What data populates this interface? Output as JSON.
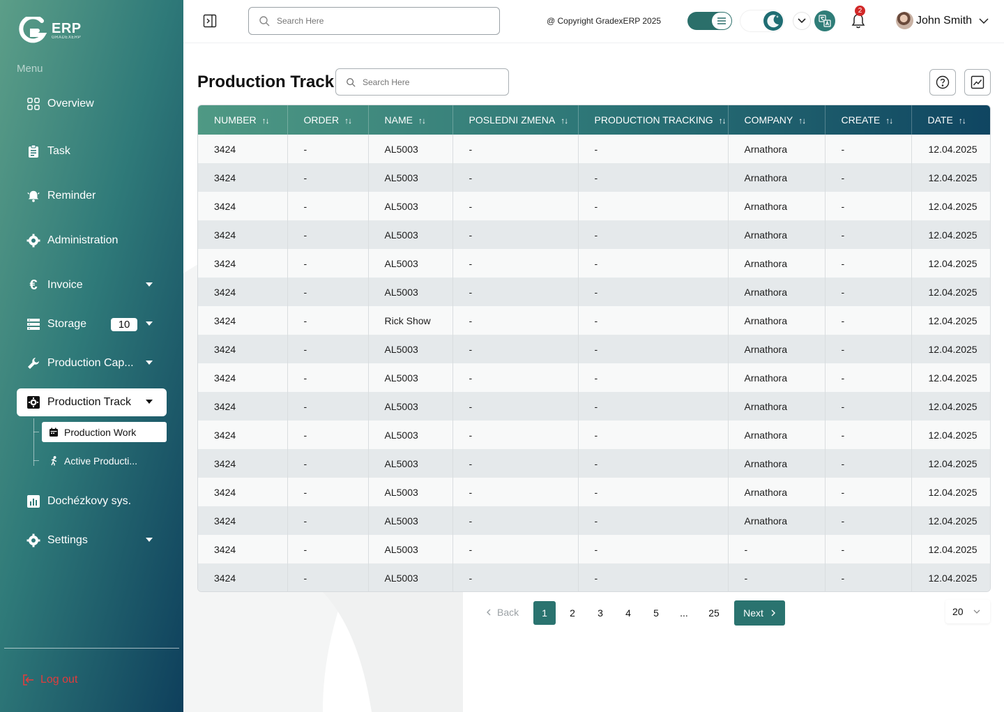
{
  "sidebar": {
    "logo": {
      "title": "ERP",
      "subtitle": "GRADEXERP"
    },
    "menu_label": "Menu",
    "items": [
      {
        "label": "Overview",
        "icon": "grid-icon"
      },
      {
        "label": "Task",
        "icon": "clipboard-icon"
      },
      {
        "label": "Reminder",
        "icon": "bell-ring-icon"
      },
      {
        "label": "Administration",
        "icon": "gear-icon"
      },
      {
        "label": "Invoice",
        "icon": "euro-icon"
      },
      {
        "label": "Storage",
        "icon": "storage-icon",
        "badge": "10"
      },
      {
        "label": "Production Cap...",
        "icon": "wrench-icon"
      },
      {
        "label": "Production Track",
        "icon": "camera-gear-icon"
      },
      {
        "label": "Dochézkovy sys.",
        "icon": "bar-chart-icon"
      },
      {
        "label": "Settings",
        "icon": "gear-icon"
      }
    ],
    "subitems": [
      {
        "label": "Production Work",
        "icon": "calendar-icon"
      },
      {
        "label": "Active Producti...",
        "icon": "running-icon"
      }
    ],
    "logout_label": "Log out"
  },
  "topbar": {
    "search_placeholder": "Search Here",
    "copyright": "@ Copyright GradexERP 2025",
    "notification_count": "2",
    "user_name": "John Smith"
  },
  "page": {
    "title": "Production Track",
    "search_placeholder": "Search Here"
  },
  "table": {
    "columns": [
      "NUMBER",
      "ORDER",
      "NAME",
      "POSLEDNI ZMENA",
      "PRODUCTION TRACKING",
      "COMPANY",
      "CREATE",
      "DATE"
    ],
    "rows": [
      [
        "3424",
        "-",
        "AL5003",
        "-",
        "-",
        "Arnathora",
        "-",
        "12.04.2025"
      ],
      [
        "3424",
        "-",
        "AL5003",
        "-",
        "-",
        "Arnathora",
        "-",
        "12.04.2025"
      ],
      [
        "3424",
        "-",
        "AL5003",
        "-",
        "-",
        "Arnathora",
        "-",
        "12.04.2025"
      ],
      [
        "3424",
        "-",
        "AL5003",
        "-",
        "-",
        "Arnathora",
        "-",
        "12.04.2025"
      ],
      [
        "3424",
        "-",
        "AL5003",
        "-",
        "-",
        "Arnathora",
        "-",
        "12.04.2025"
      ],
      [
        "3424",
        "-",
        "AL5003",
        "-",
        "-",
        "Arnathora",
        "-",
        "12.04.2025"
      ],
      [
        "3424",
        "-",
        "Rick Show",
        "-",
        "-",
        "Arnathora",
        "-",
        "12.04.2025"
      ],
      [
        "3424",
        "-",
        "AL5003",
        "-",
        "-",
        "Arnathora",
        "-",
        "12.04.2025"
      ],
      [
        "3424",
        "-",
        "AL5003",
        "-",
        "-",
        "Arnathora",
        "-",
        "12.04.2025"
      ],
      [
        "3424",
        "-",
        "AL5003",
        "-",
        "-",
        "Arnathora",
        "-",
        "12.04.2025"
      ],
      [
        "3424",
        "-",
        "AL5003",
        "-",
        "-",
        "Arnathora",
        "-",
        "12.04.2025"
      ],
      [
        "3424",
        "-",
        "AL5003",
        "-",
        "-",
        "Arnathora",
        "-",
        "12.04.2025"
      ],
      [
        "3424",
        "-",
        "AL5003",
        "-",
        "-",
        "Arnathora",
        "-",
        "12.04.2025"
      ],
      [
        "3424",
        "-",
        "AL5003",
        "-",
        "-",
        "Arnathora",
        "-",
        "12.04.2025"
      ],
      [
        "3424",
        "-",
        "AL5003",
        "-",
        "-",
        "-",
        "-",
        "12.04.2025"
      ],
      [
        "3424",
        "-",
        "AL5003",
        "-",
        "-",
        "-",
        "-",
        "12.04.2025"
      ]
    ]
  },
  "pagination": {
    "back_label": "Back",
    "pages": [
      "1",
      "2",
      "3",
      "4",
      "5",
      "...",
      "25"
    ],
    "current": "1",
    "next_label": "Next",
    "per_page": "20"
  },
  "colors": {
    "accent": "#2a736f",
    "sidebar_dark": "#0e3f5c",
    "sidebar_light": "#5c9e88",
    "danger": "#e23c3c"
  }
}
